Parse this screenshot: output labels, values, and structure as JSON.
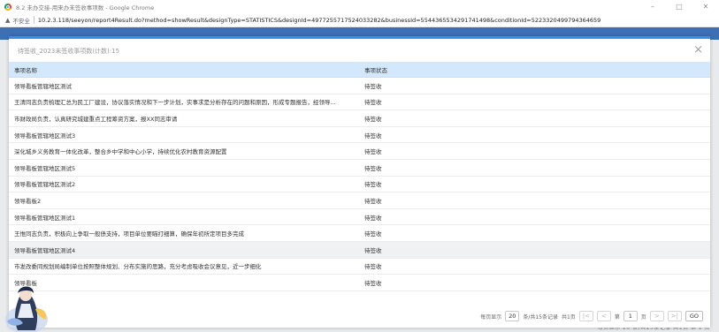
{
  "window": {
    "title": "8.2 未办交接-用来办未签收事项数 - Google Chrome",
    "minimize": "–",
    "maximize": "□",
    "close": "✕"
  },
  "address": {
    "security_label": "不安全",
    "url": "10.2.3.118/seeyon/report4Result.do?method=showResult&designType=STATISTICS&designId=4977255717524033282&businessId=5544365534291741498&conditionId=5223320499794364659"
  },
  "background": {
    "footer_text": "每页显示 20 条/共25条记录 共1页 第 1 页"
  },
  "modal": {
    "title": "待签收_2023未签收事项数(计数):15",
    "close": "×",
    "table": {
      "headers": [
        "事项名称",
        "事项状态"
      ],
      "rows": [
        {
          "name": "领导看板管辖地区测试",
          "status": "待签收"
        },
        {
          "name": "王清同志负责梳理汇总为民工厂建设，协议落实情况和下一步计划，实事求是分析存在的问题和原因，形成专题报告，经领导...",
          "status": "待签收"
        },
        {
          "name": "市财政局负责，认真研究城建重点工程筹资方案，报XX同志审请",
          "status": "待签收"
        },
        {
          "name": "领导看板管辖地区测试3",
          "status": "待签收"
        },
        {
          "name": "深化城乡义务教育一体化改革，整合乡中学和中心小学，持续优化农村教育资源配置",
          "status": "待签收"
        },
        {
          "name": "领导看板管辖地区测试5",
          "status": "待签收"
        },
        {
          "name": "领导看板管辖地区测试2",
          "status": "待签收"
        },
        {
          "name": "领导看板2",
          "status": "待签收"
        },
        {
          "name": "领导看板管辖地区测试1",
          "status": "待签收"
        },
        {
          "name": "王惟同志负责，积极向上争取一般债支持，项目单位要瞄打细算，确保年初所定项目多完成",
          "status": "待签收"
        },
        {
          "name": "领导看板管辖地区测试4",
          "status": "待签收"
        },
        {
          "name": "市发改委同规划局编制单位按照整体规划、分布实施的思路，充分考虑吸收会议意见，近一步细化",
          "status": "待签收"
        },
        {
          "name": "领导看板",
          "status": "待签收"
        }
      ]
    },
    "pager": {
      "per_page_label": "每页显示",
      "per_page_value": "20",
      "records_label": "条/共15条记录",
      "total_pages": "共1页",
      "first": "|<",
      "prev": "<",
      "page_prefix": "第",
      "current_page": "1",
      "page_suffix": "页",
      "next": ">",
      "last": ">|",
      "go": "GO"
    }
  },
  "colors": {
    "header_bg": "#d3e8fb",
    "accent": "#3a8ee6",
    "highlight_row": "#f0f1f3"
  }
}
